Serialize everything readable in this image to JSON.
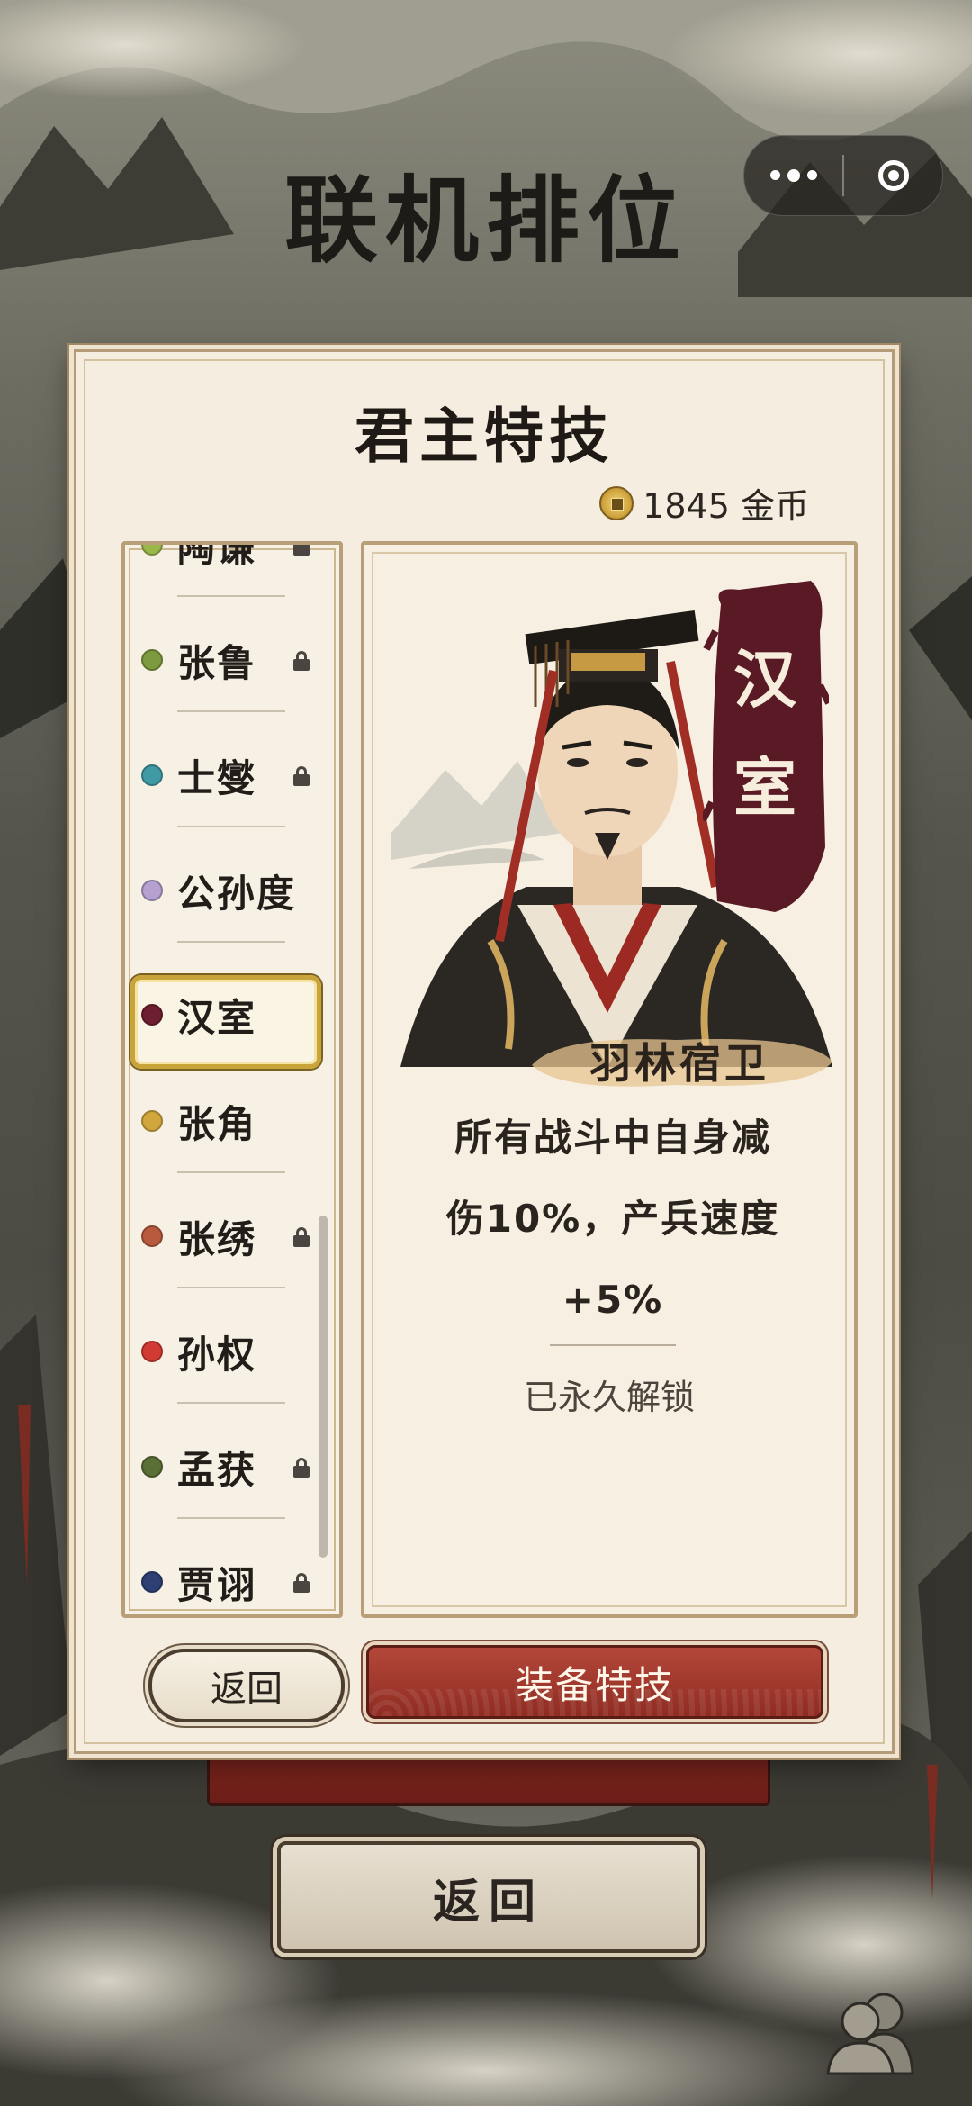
{
  "page": {
    "title": "联机排位"
  },
  "capsule": {
    "more_icon": "more-dots-icon",
    "close_icon": "target-close-icon"
  },
  "modal": {
    "title": "君主特技",
    "coins": {
      "amount_text": "1845 金币",
      "icon": "coin-icon"
    }
  },
  "lords": [
    {
      "name": "陶谦",
      "dot_color": "#9bb84a",
      "locked": true,
      "selected": false
    },
    {
      "name": "张鲁",
      "dot_color": "#7e9a3e",
      "locked": true,
      "selected": false
    },
    {
      "name": "士燮",
      "dot_color": "#3f9aa6",
      "locked": true,
      "selected": false
    },
    {
      "name": "公孙度",
      "dot_color": "#b5a0cf",
      "locked": false,
      "selected": false
    },
    {
      "name": "汉室",
      "dot_color": "#6e1f2f",
      "locked": false,
      "selected": true
    },
    {
      "name": "张角",
      "dot_color": "#d1a63c",
      "locked": false,
      "selected": false
    },
    {
      "name": "张绣",
      "dot_color": "#b85a3e",
      "locked": true,
      "selected": false
    },
    {
      "name": "孙权",
      "dot_color": "#d23b34",
      "locked": false,
      "selected": false
    },
    {
      "name": "孟获",
      "dot_color": "#5a6f35",
      "locked": true,
      "selected": false
    },
    {
      "name": "贾诩",
      "dot_color": "#2e3f73",
      "locked": true,
      "selected": false
    }
  ],
  "detail": {
    "banner_text": "汉室",
    "skill_name": "羽林宿卫",
    "desc_line1": "所有战斗中自身减",
    "desc_line2_pre": "伤",
    "desc_line2_num": "10%",
    "desc_line2_post": "，产兵速度",
    "desc_line3": "+5%",
    "status": "已永久解锁"
  },
  "buttons": {
    "modal_back": "返回",
    "equip": "装备特技",
    "page_back": "返回"
  },
  "colors": {
    "equip_red": "#a03a2e",
    "gold_highlight": "#c9a43b",
    "banner": "#5a1a25"
  }
}
